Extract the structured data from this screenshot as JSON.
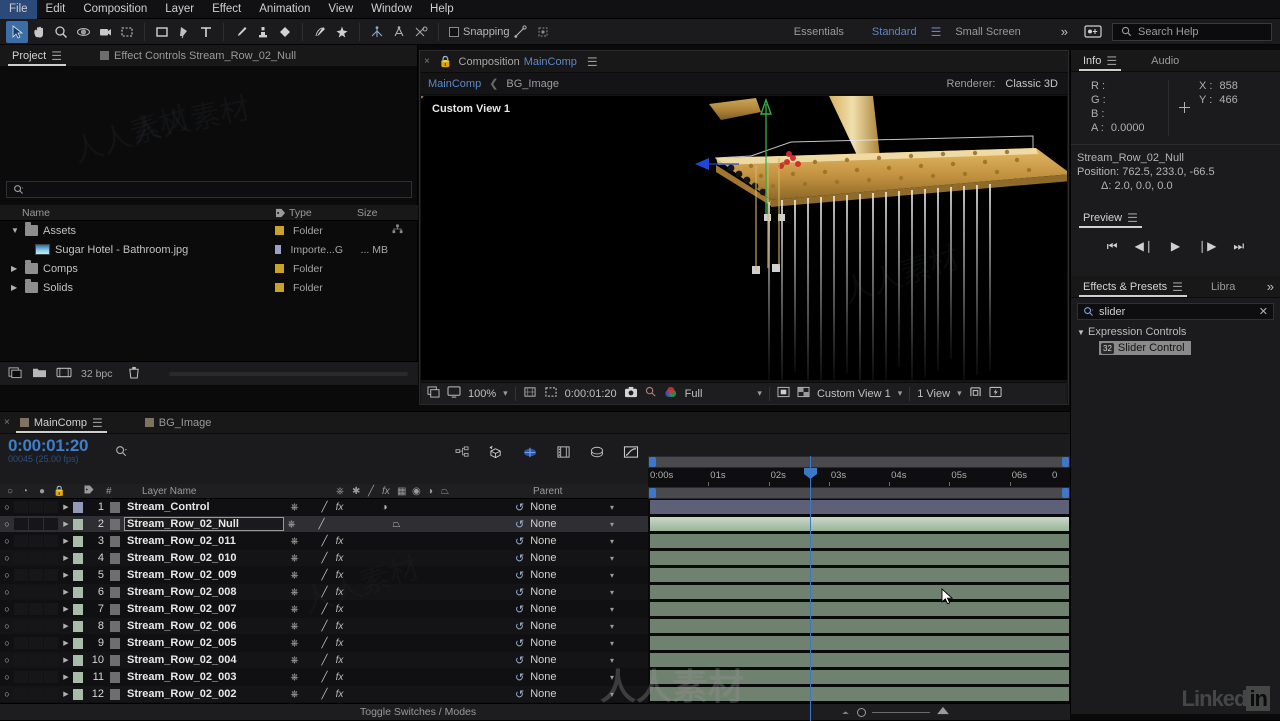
{
  "menubar": {
    "items": [
      "File",
      "Edit",
      "Composition",
      "Layer",
      "Effect",
      "Animation",
      "View",
      "Window",
      "Help"
    ]
  },
  "toolbar": {
    "snapping_label": "Snapping",
    "workspaces": [
      "Essentials",
      "Standard",
      "Small Screen"
    ],
    "active_workspace": "Standard",
    "overflow": "»",
    "search_placeholder": "Search Help"
  },
  "project_panel": {
    "tabs": [
      {
        "label": "Project",
        "active": true
      },
      {
        "label": "Effect Controls Stream_Row_02_Null",
        "active": false
      }
    ],
    "search_value": "",
    "columns": [
      "Name",
      "Type",
      "Size"
    ],
    "rows": [
      {
        "name": "Assets",
        "type": "Folder",
        "size": "",
        "kind": "folder",
        "indent": 0,
        "expanded": true,
        "swatch": "#c9a227",
        "has_share_icon": true
      },
      {
        "name": "Sugar Hotel - Bathroom.jpg",
        "type": "Importe...G",
        "size": "... MB",
        "kind": "image",
        "indent": 1,
        "swatch": "#9aa0c8"
      },
      {
        "name": "Comps",
        "type": "Folder",
        "size": "",
        "kind": "folder",
        "indent": 0,
        "expanded": false,
        "swatch": "#c9a227"
      },
      {
        "name": "Solids",
        "type": "Folder",
        "size": "",
        "kind": "folder",
        "indent": 0,
        "expanded": false,
        "swatch": "#c9a227"
      }
    ],
    "bit_depth": "32 bpc"
  },
  "comp_panel": {
    "tab_title_prefix": "Composition",
    "tab_title": "MainComp",
    "breadcrumb": [
      "MainComp",
      "BG_Image"
    ],
    "renderer_label": "Renderer:",
    "renderer_value": "Classic 3D",
    "view_label": "Custom View 1",
    "footer": {
      "zoom": "100%",
      "timecode": "0:00:01:20",
      "resolution": "Full",
      "view_layout_name": "Custom View 1",
      "views": "1 View"
    }
  },
  "info_panel": {
    "tabs": [
      {
        "label": "Info",
        "active": true
      },
      {
        "label": "Audio",
        "active": false
      }
    ],
    "r_label": "R :",
    "r_value": "",
    "g_label": "G :",
    "g_value": "",
    "b_label": "B :",
    "b_value": "",
    "a_label": "A :",
    "a_value": "0.0000",
    "x_label": "X :",
    "x_value": "858",
    "y_label": "Y :",
    "y_value": "466",
    "layer_name": "Stream_Row_02_Null",
    "position_line": "Position: 762.5, 233.0, -66.5",
    "delta_line": "Δ: 2.0, 0.0, 0.0"
  },
  "preview_panel": {
    "title": "Preview"
  },
  "effects_panel": {
    "tabs": [
      {
        "label": "Effects & Presets",
        "active": true
      },
      {
        "label": "Libra",
        "active": false
      }
    ],
    "search_value": "slider",
    "group": "Expression Controls",
    "item": "Slider Control",
    "item_badge": "32"
  },
  "timeline": {
    "tabs": [
      {
        "label": "MainComp",
        "active": true
      },
      {
        "label": "BG_Image",
        "active": false
      }
    ],
    "current_time": "0:00:01:20",
    "frame_info": "00045 (25.00 fps)",
    "columns": {
      "layer_name": "Layer Name",
      "parent": "Parent",
      "hash": "#"
    },
    "ruler_labels": [
      "0:00s",
      "01s",
      "02s",
      "03s",
      "04s",
      "05s",
      "06s",
      "0"
    ],
    "footer_label": "Toggle Switches / Modes",
    "layers": [
      {
        "num": "1",
        "name": "Stream_Control",
        "parent": "None",
        "bar": "blue",
        "selected": false,
        "editing": false,
        "fx": true,
        "threeD": false,
        "color": "#9198b8"
      },
      {
        "num": "2",
        "name": "Stream_Row_02_Null",
        "parent": "None",
        "bar": "selgreen",
        "selected": true,
        "editing": true,
        "fx": false,
        "threeD": true,
        "color": "#a8bda8"
      },
      {
        "num": "3",
        "name": "Stream_Row_02_011",
        "parent": "None",
        "bar": "green",
        "selected": false,
        "editing": false,
        "fx": true,
        "threeD": false,
        "color": "#a8bda8"
      },
      {
        "num": "4",
        "name": "Stream_Row_02_010",
        "parent": "None",
        "bar": "green",
        "selected": false,
        "editing": false,
        "fx": true,
        "threeD": false,
        "color": "#a8bda8"
      },
      {
        "num": "5",
        "name": "Stream_Row_02_009",
        "parent": "None",
        "bar": "green",
        "selected": false,
        "editing": false,
        "fx": true,
        "threeD": false,
        "color": "#a8bda8"
      },
      {
        "num": "6",
        "name": "Stream_Row_02_008",
        "parent": "None",
        "bar": "green",
        "selected": false,
        "editing": false,
        "fx": true,
        "threeD": false,
        "color": "#a8bda8"
      },
      {
        "num": "7",
        "name": "Stream_Row_02_007",
        "parent": "None",
        "bar": "green",
        "selected": false,
        "editing": false,
        "fx": true,
        "threeD": false,
        "color": "#a8bda8"
      },
      {
        "num": "8",
        "name": "Stream_Row_02_006",
        "parent": "None",
        "bar": "green",
        "selected": false,
        "editing": false,
        "fx": true,
        "threeD": false,
        "color": "#a8bda8"
      },
      {
        "num": "9",
        "name": "Stream_Row_02_005",
        "parent": "None",
        "bar": "green",
        "selected": false,
        "editing": false,
        "fx": true,
        "threeD": false,
        "color": "#a8bda8"
      },
      {
        "num": "10",
        "name": "Stream_Row_02_004",
        "parent": "None",
        "bar": "green",
        "selected": false,
        "editing": false,
        "fx": true,
        "threeD": false,
        "color": "#a8bda8"
      },
      {
        "num": "11",
        "name": "Stream_Row_02_003",
        "parent": "None",
        "bar": "green",
        "selected": false,
        "editing": false,
        "fx": true,
        "threeD": false,
        "color": "#a8bda8"
      },
      {
        "num": "12",
        "name": "Stream_Row_02_002",
        "parent": "None",
        "bar": "green",
        "selected": false,
        "editing": false,
        "fx": true,
        "threeD": false,
        "color": "#a8bda8"
      }
    ]
  },
  "watermark": {
    "cn": "人人素材",
    "brand": "Linked",
    "brand_suffix": "in"
  },
  "colors": {
    "accent": "#3c78c8",
    "link": "#5d87c9",
    "panel": "#1b1b1d",
    "bar_green": "#6f816f"
  }
}
